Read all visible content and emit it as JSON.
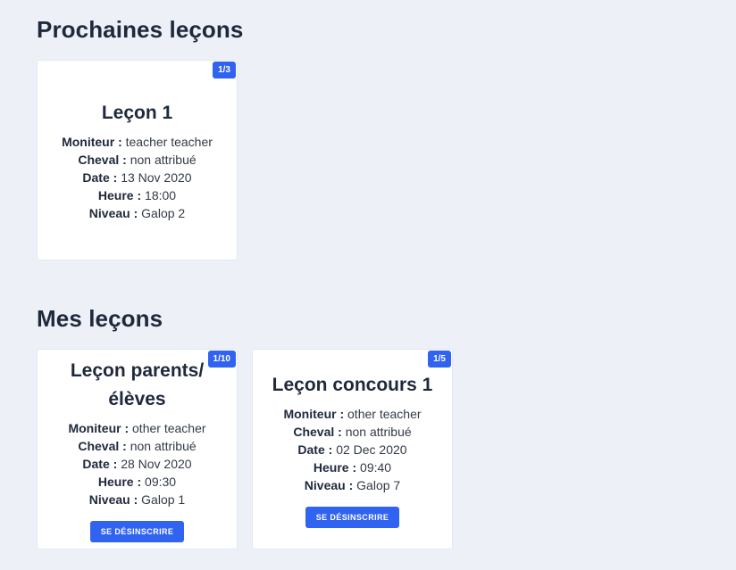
{
  "upcoming": {
    "title": "Prochaines leçons",
    "cards": [
      {
        "badge": "1/3",
        "title": "Leçon 1",
        "fields": [
          {
            "label": "Moniteur :",
            "value": "teacher teacher"
          },
          {
            "label": "Cheval :",
            "value": "non attribué"
          },
          {
            "label": "Date :",
            "value": "13 Nov 2020"
          },
          {
            "label": "Heure :",
            "value": "18:00"
          },
          {
            "label": "Niveau :",
            "value": "Galop 2"
          }
        ]
      }
    ]
  },
  "mine": {
    "title": "Mes leçons",
    "cards": [
      {
        "badge": "1/10",
        "title": "Leçon parents/élèves",
        "fields": [
          {
            "label": "Moniteur :",
            "value": "other teacher"
          },
          {
            "label": "Cheval :",
            "value": "non attribué"
          },
          {
            "label": "Date :",
            "value": "28 Nov 2020"
          },
          {
            "label": "Heure :",
            "value": "09:30"
          },
          {
            "label": "Niveau :",
            "value": "Galop 1"
          }
        ],
        "button": "SE DÉSINSCRIRE"
      },
      {
        "badge": "1/5",
        "title": "Leçon concours 1",
        "fields": [
          {
            "label": "Moniteur :",
            "value": "other teacher"
          },
          {
            "label": "Cheval :",
            "value": "non attribué"
          },
          {
            "label": "Date :",
            "value": "02 Dec 2020"
          },
          {
            "label": "Heure :",
            "value": "09:40"
          },
          {
            "label": "Niveau :",
            "value": "Galop 7"
          }
        ],
        "button": "SE DÉSINSCRIRE"
      }
    ]
  },
  "colors": {
    "accent": "#3063f0",
    "background": "#edf0f7",
    "card": "#ffffff"
  }
}
